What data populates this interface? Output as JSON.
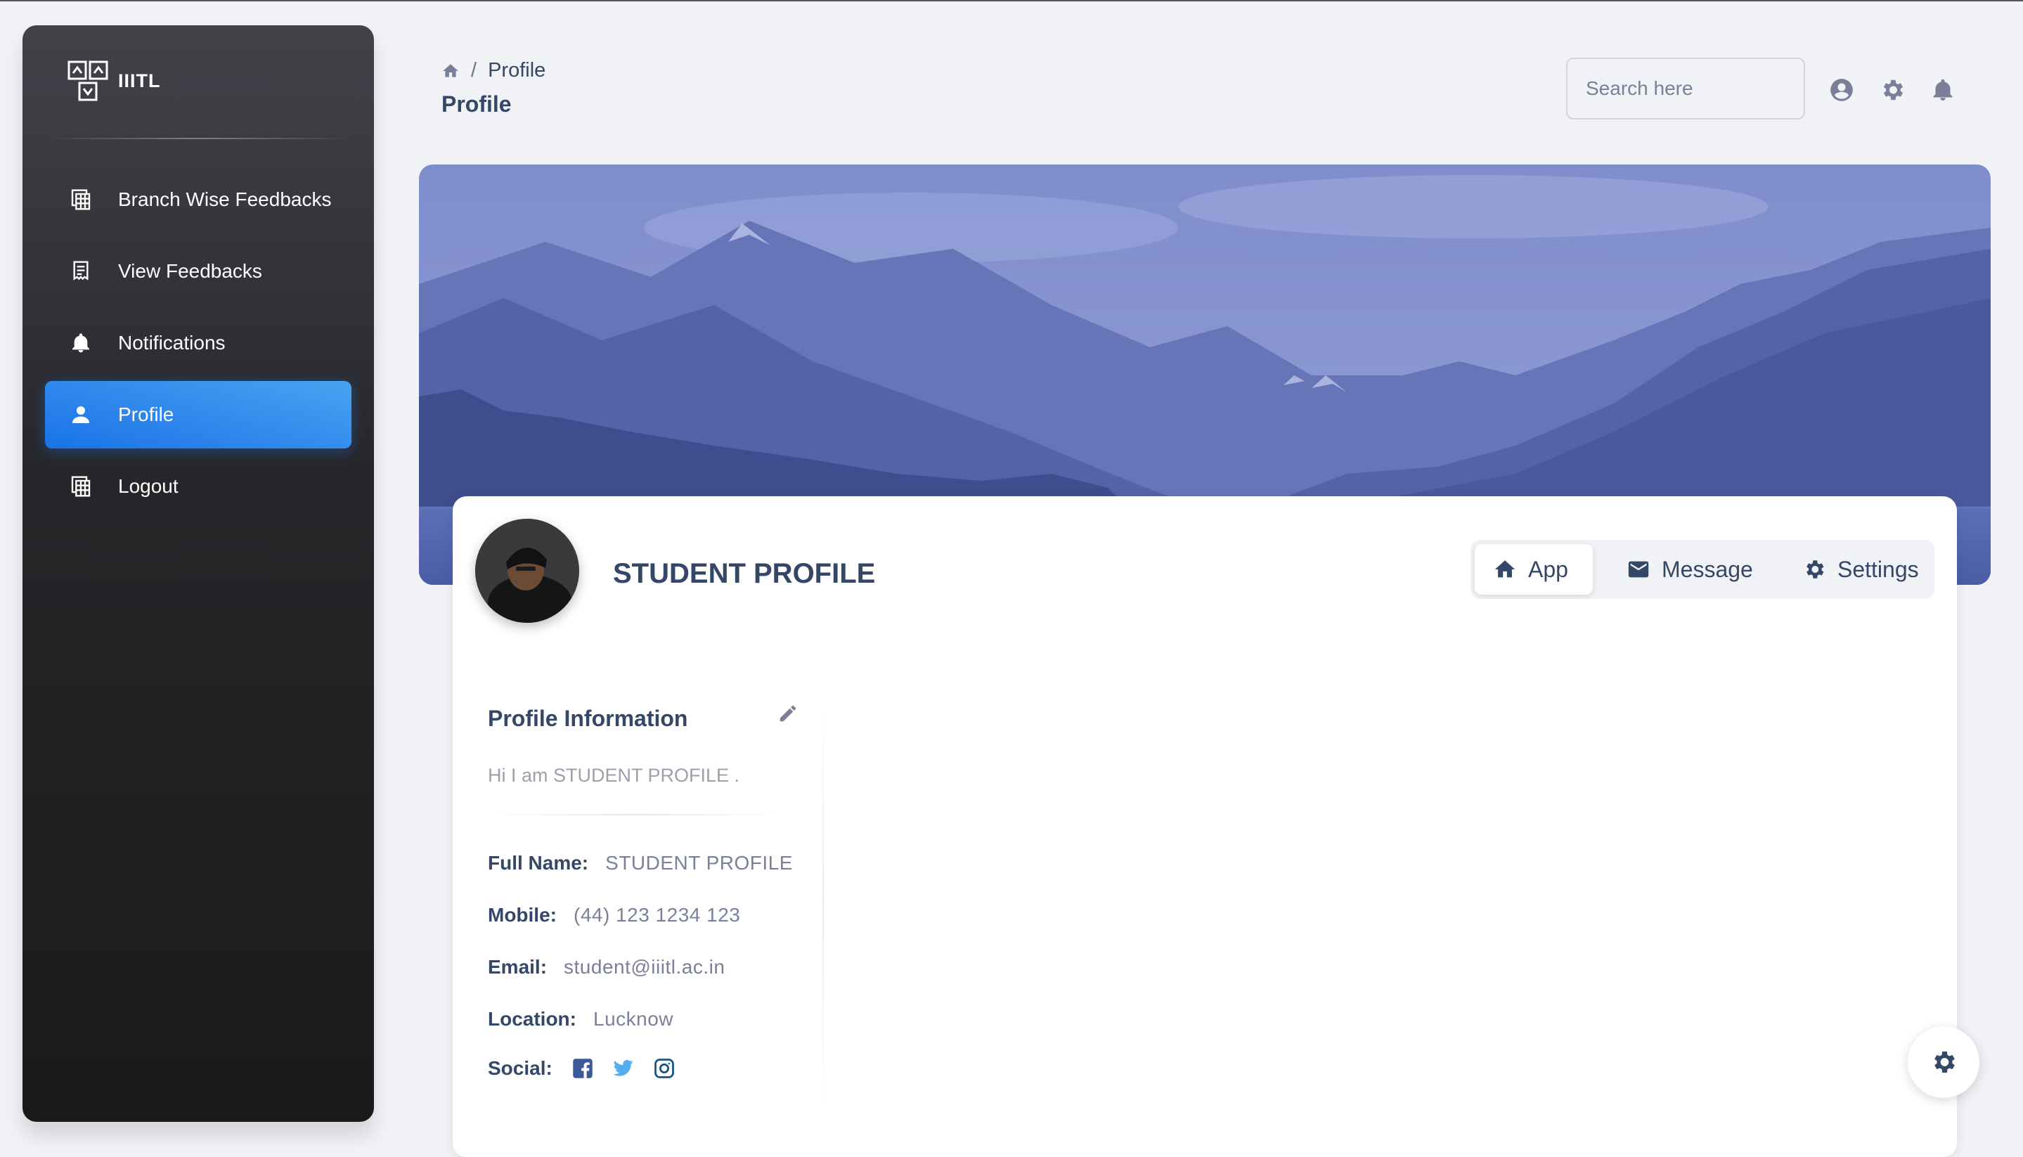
{
  "brand": {
    "name": "IIITL"
  },
  "sidebar": {
    "items": [
      {
        "label": "Branch Wise Feedbacks",
        "icon": "table-icon"
      },
      {
        "label": "View Feedbacks",
        "icon": "receipt-icon"
      },
      {
        "label": "Notifications",
        "icon": "bell-icon"
      },
      {
        "label": "Profile",
        "icon": "person-icon",
        "active": true
      },
      {
        "label": "Logout",
        "icon": "table-icon"
      }
    ]
  },
  "header": {
    "breadcrumb": {
      "separator": "/",
      "current": "Profile"
    },
    "title": "Profile",
    "search": {
      "placeholder": "Search here",
      "value": ""
    }
  },
  "profile": {
    "name": "STUDENT PROFILE",
    "tabs": [
      {
        "label": "App",
        "icon": "home-icon",
        "active": true
      },
      {
        "label": "Message",
        "icon": "email-icon"
      },
      {
        "label": "Settings",
        "icon": "gear-icon"
      }
    ],
    "info": {
      "title": "Profile Information",
      "bio": "Hi I am STUDENT PROFILE .",
      "fields": [
        {
          "label": "Full Name:",
          "value": "STUDENT PROFILE"
        },
        {
          "label": "Mobile:",
          "value": "(44) 123 1234 123"
        },
        {
          "label": "Email:",
          "value": "student@iiitl.ac.in"
        },
        {
          "label": "Location:",
          "value": "Lucknow"
        }
      ],
      "social_label": "Social:",
      "social": [
        "facebook-icon",
        "twitter-icon",
        "instagram-icon"
      ]
    }
  },
  "colors": {
    "accent": "#1a73e8",
    "text": "#344767",
    "muted": "#7b809a",
    "facebook": "#3b5998",
    "twitter": "#55acee",
    "instagram": "#125688"
  }
}
